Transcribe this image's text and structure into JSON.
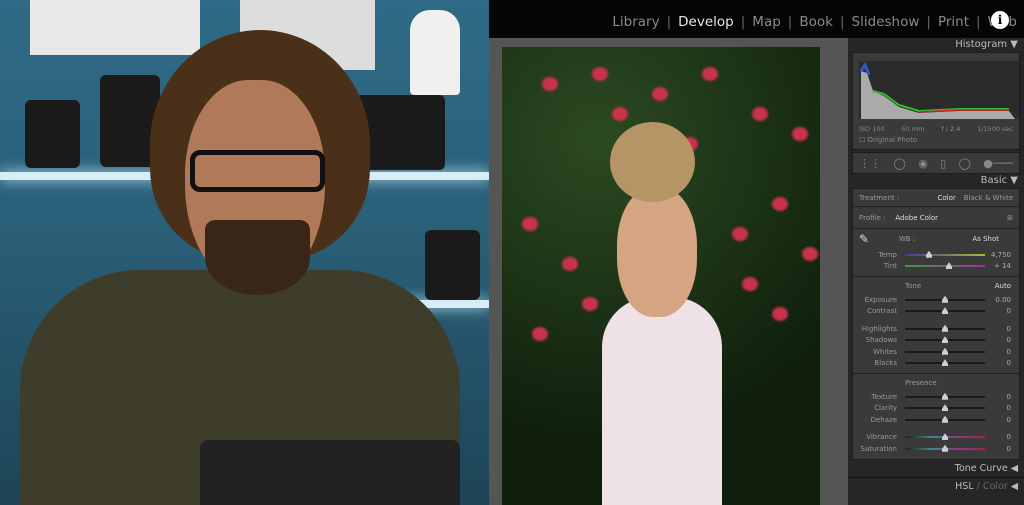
{
  "modules": [
    "Library",
    "Develop",
    "Map",
    "Book",
    "Slideshow",
    "Print",
    "Web"
  ],
  "active_module": "Develop",
  "histogram": {
    "title": "Histogram",
    "iso": "ISO 100",
    "focal": "50 mm",
    "aperture": "f / 2.4",
    "shutter": "1/1500 sec",
    "original_photo": "Original Photo"
  },
  "basic": {
    "title": "Basic",
    "treatment_label": "Treatment :",
    "treatment_color": "Color",
    "treatment_bw": "Black & White",
    "profile_label": "Profile :",
    "profile_value": "Adobe Color",
    "wb_label": "WB :",
    "wb_value": "As Shot",
    "tone_label": "Tone",
    "auto_label": "Auto",
    "presence_label": "Presence",
    "sliders": [
      {
        "label": "Temp",
        "value": "4,750",
        "level": 0.3
      },
      {
        "label": "Tint",
        "value": "+ 14",
        "level": 0.55
      },
      {
        "label": "Exposure",
        "value": "0.00",
        "level": 0.5
      },
      {
        "label": "Contrast",
        "value": "0",
        "level": 0.5
      },
      {
        "label": "Highlights",
        "value": "0",
        "level": 0.5
      },
      {
        "label": "Shadows",
        "value": "0",
        "level": 0.5
      },
      {
        "label": "Whites",
        "value": "0",
        "level": 0.5
      },
      {
        "label": "Blacks",
        "value": "0",
        "level": 0.5
      },
      {
        "label": "Texture",
        "value": "0",
        "level": 0.5
      },
      {
        "label": "Clarity",
        "value": "0",
        "level": 0.5
      },
      {
        "label": "Dehaze",
        "value": "0",
        "level": 0.5
      },
      {
        "label": "Vibrance",
        "value": "0",
        "level": 0.5
      },
      {
        "label": "Saturation",
        "value": "0",
        "level": 0.5
      }
    ]
  },
  "tone_curve": "Tone Curve",
  "hsl": "HSL",
  "hsl_color": "/ Color",
  "colors": {
    "panel": "#262626",
    "panel_box": "#3a3a3a",
    "topbar": "#050505",
    "accent_red": "#c8324a"
  }
}
